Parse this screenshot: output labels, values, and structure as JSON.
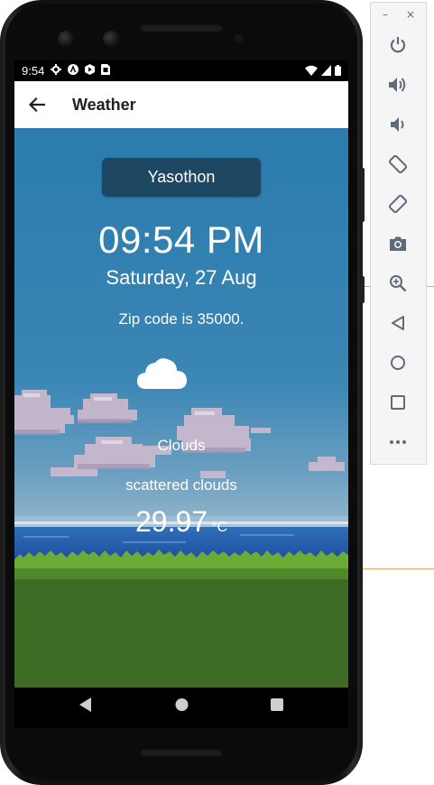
{
  "status_bar": {
    "time": "9:54"
  },
  "app_bar": {
    "title": "Weather"
  },
  "weather": {
    "city": "Yasothon",
    "time": "09:54 PM",
    "date": "Saturday, 27 Aug",
    "zip_text": "Zip code is 35000.",
    "condition": "Clouds",
    "description": "scattered clouds",
    "temperature": "29.97",
    "unit": "°C",
    "icon": "cloud-icon"
  },
  "toolbar": {
    "minimize": "–",
    "close": "×",
    "buttons": [
      "power-icon",
      "volume-up-icon",
      "volume-down-icon",
      "rotate-left-icon",
      "rotate-right-icon",
      "camera-icon",
      "zoom-icon",
      "back-icon",
      "home-icon",
      "overview-icon",
      "more-icon"
    ]
  },
  "colors": {
    "sky": "#2b7cad",
    "city_button": "#1e4763",
    "app_bar": "#ffffff",
    "grass": "#3d6b23"
  }
}
